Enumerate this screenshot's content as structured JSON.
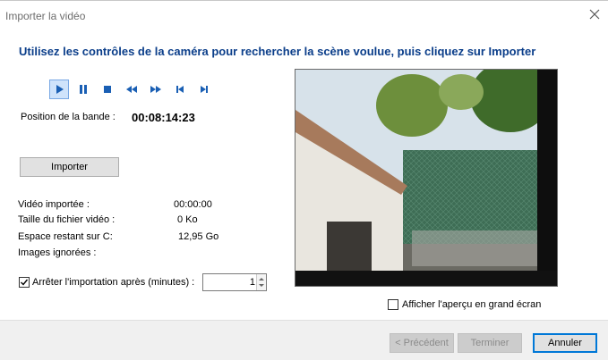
{
  "window": {
    "title": "Importer la vidéo",
    "close_icon": "close-icon"
  },
  "heading": "Utilisez les contrôles de la caméra pour rechercher la scène voulue, puis cliquez sur Importer",
  "transport": {
    "buttons": [
      {
        "name": "play-icon",
        "active": true
      },
      {
        "name": "pause-icon",
        "active": false
      },
      {
        "name": "stop-icon",
        "active": false
      },
      {
        "name": "rewind-icon",
        "active": false
      },
      {
        "name": "fast-forward-icon",
        "active": false
      },
      {
        "name": "step-back-icon",
        "active": false
      },
      {
        "name": "step-forward-icon",
        "active": false
      }
    ]
  },
  "tape": {
    "label": "Position de la bande :",
    "value": "00:08:14:23"
  },
  "import_button": "Importer",
  "stats": {
    "imported_label": "Vidéo importée :",
    "imported_value": "00:00:00",
    "size_label": "Taille du fichier vidéo :",
    "size_value": "0 Ko",
    "space_label": "Espace restant sur C:",
    "space_value": "12,95 Go",
    "ignored_label": "Images ignorées :"
  },
  "stop_after": {
    "label": "Arrêter l'importation après (minutes) :",
    "checked": true,
    "value": "1"
  },
  "fullscreen_preview": {
    "label": "Afficher l'aperçu en grand écran",
    "checked": false
  },
  "footer": {
    "previous": "< Précédent",
    "finish": "Terminer",
    "cancel": "Annuler"
  },
  "colors": {
    "heading": "#0b3e8a",
    "transport_icons": "#1a5fb4",
    "active_button_bg": "#cfe3fb"
  }
}
